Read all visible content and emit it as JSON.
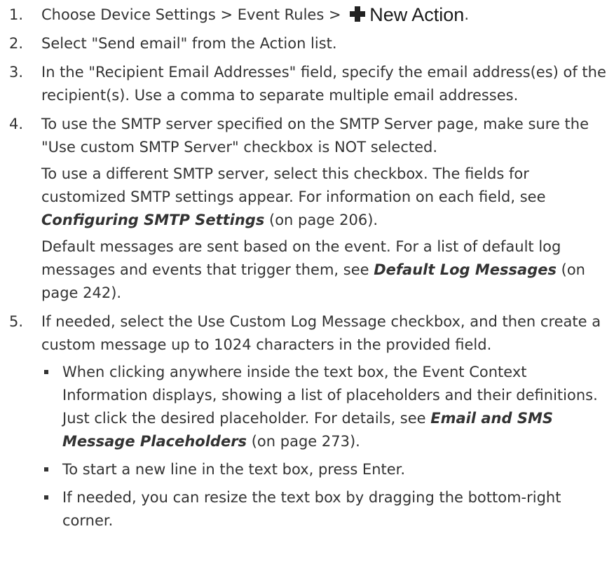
{
  "steps": [
    {
      "num": "1.",
      "text_before": "Choose Device Settings > Event Rules >",
      "button_label": "New Action",
      "text_after": "."
    },
    {
      "num": "2.",
      "text": "Select \"Send email\" from the Action list."
    },
    {
      "num": "3.",
      "text": "In the \"Recipient Email Addresses\" field, specify the email address(es) of the recipient(s). Use a comma to separate multiple email addresses."
    },
    {
      "num": "4.",
      "text": "To use the SMTP server specified on the SMTP Server page, make sure the \"Use custom SMTP Server\" checkbox is NOT selected.",
      "para2_before": "To use a different SMTP server, select this checkbox. The fields for customized SMTP settings appear. For information on each field, see ",
      "para2_link": "Configuring SMTP Settings",
      "para2_after": " (on page 206).",
      "para3_before": "Default messages are sent based on the event. For a list of default log messages and events that trigger them, see ",
      "para3_link": "Default Log Messages",
      "para3_after": " (on page 242)."
    },
    {
      "num": "5.",
      "text": "If needed, select the Use Custom Log Message checkbox, and then create a custom message up to 1024 characters in the provided field.",
      "bullets": [
        {
          "before": "When clicking anywhere inside the text box, the Event Context Information displays, showing a list of placeholders and their definitions. Just click the desired placeholder. For details, see ",
          "link": "Email and SMS Message Placeholders",
          "after": " (on page 273)."
        },
        {
          "text": "To start a new line in the text box, press Enter."
        },
        {
          "text": "If needed, you can resize the text box by dragging the bottom-right corner."
        }
      ]
    }
  ]
}
